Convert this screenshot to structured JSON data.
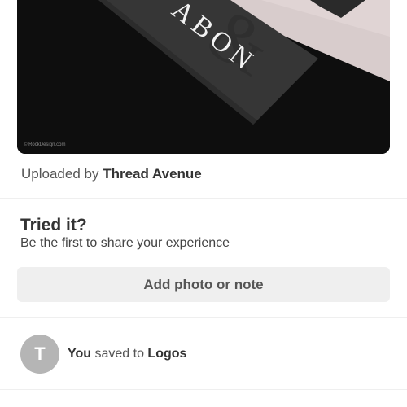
{
  "pin": {
    "card_text": "ABON",
    "watermark": "© RockDesign.com"
  },
  "uploader": {
    "prefix": "Uploaded by",
    "name": "Thread Avenue"
  },
  "tried": {
    "title": "Tried it?",
    "subtitle": "Be the first to share your experience",
    "button_label": "Add photo or note"
  },
  "activity": {
    "avatar_initial": "T",
    "actor": "You",
    "verb": "saved to",
    "board": "Logos"
  },
  "colors": {
    "image_bg": "#0e0e0e",
    "button_bg": "#efefef",
    "avatar_bg": "#b5b5b5"
  }
}
